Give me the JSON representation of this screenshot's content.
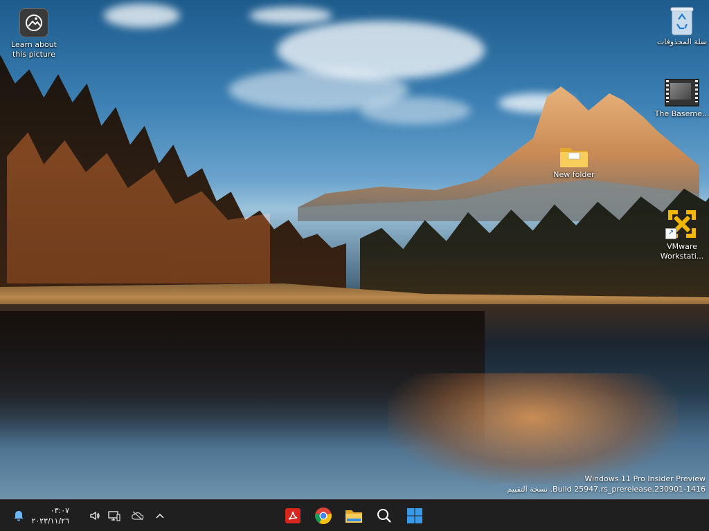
{
  "desktop": {
    "icons": [
      {
        "label": "Learn about this picture",
        "icon": "learn-picture-icon"
      },
      {
        "label": "سلة المحذوفات",
        "icon": "recycle-bin-icon"
      },
      {
        "label": "The Baseme...",
        "icon": "video-file-icon"
      },
      {
        "label": "New folder",
        "icon": "folder-icon"
      },
      {
        "label": "VMware Workstati...",
        "icon": "vmware-icon"
      }
    ]
  },
  "watermark": {
    "line1": "Windows 11 Pro Insider Preview",
    "line2": "نسخة التقييم .Build 25947.rs_prerelease.230901-1416"
  },
  "taskbar": {
    "clock_time": "٠٣:٠٧",
    "clock_date": "٢٠٢٣/١١/٢٦",
    "tray_icons": [
      "notification-bell-icon",
      "speaker-icon",
      "network-monitor-icon",
      "cloud-offline-icon",
      "chevron-up-icon"
    ],
    "apps": [
      "acrobat-icon",
      "chrome-icon",
      "file-explorer-icon",
      "search-icon",
      "start-icon"
    ]
  },
  "colors": {
    "taskbar_bg": "#1f1f1f",
    "accent_blue": "#3b9ae8",
    "folder_yellow": "#f0c14b",
    "vmware_yellow": "#f2b700",
    "acrobat_red": "#d7261e"
  }
}
